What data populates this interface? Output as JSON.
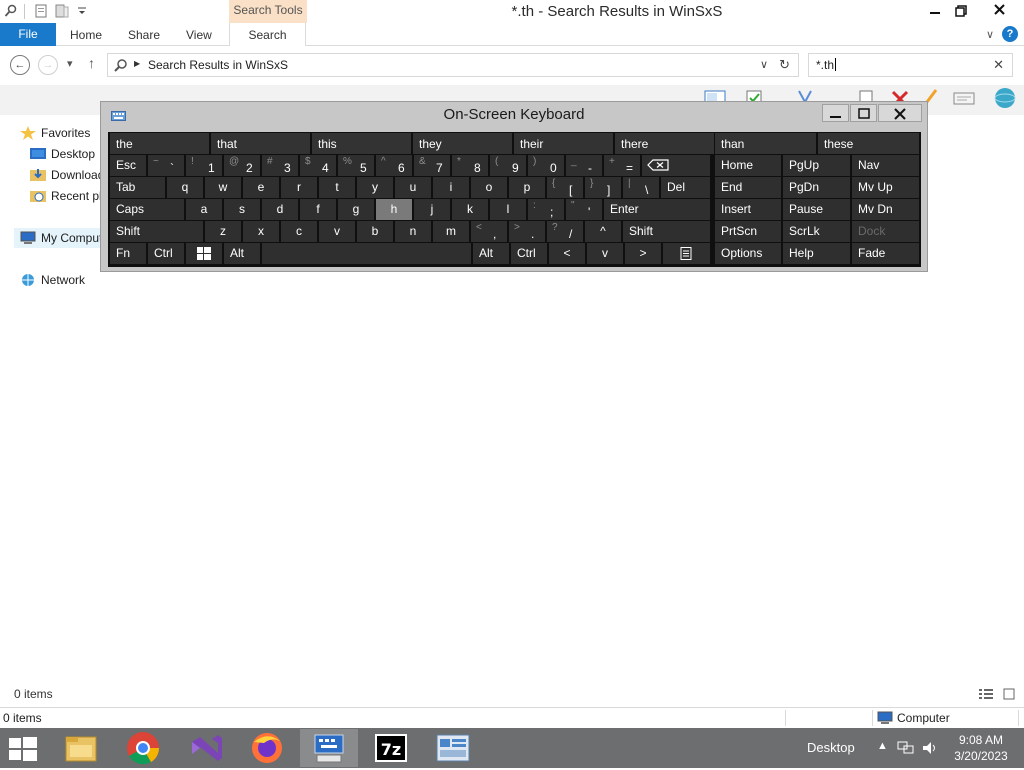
{
  "window": {
    "title": "*.th - Search Results in WinSxS",
    "context_tab": "Search Tools"
  },
  "ribbon": {
    "tabs": [
      {
        "label": "File"
      },
      {
        "label": "Home"
      },
      {
        "label": "Share"
      },
      {
        "label": "View"
      },
      {
        "label": "Search"
      }
    ],
    "help_label": "?"
  },
  "address": {
    "path": "Search Results in WinSxS"
  },
  "search": {
    "value": "*.th"
  },
  "navigation": {
    "items": [
      {
        "label": "Favorites",
        "icon": "star-icon"
      },
      {
        "label": "Desktop",
        "icon": "desktop-icon"
      },
      {
        "label": "Downloads",
        "icon": "downloads-icon"
      },
      {
        "label": "Recent places",
        "icon": "recent-places-icon"
      },
      {
        "label": "My Computer",
        "icon": "computer-icon"
      },
      {
        "label": "Network",
        "icon": "network-icon"
      }
    ]
  },
  "status": {
    "items_count": "0 items",
    "bar_items": "0 items",
    "location": "Computer"
  },
  "osk": {
    "title": "On-Screen Keyboard",
    "predictions": [
      "the",
      "that",
      "this",
      "they",
      "their",
      "there",
      "than",
      "these"
    ],
    "keys": {
      "esc": "Esc",
      "tab": "Tab",
      "caps": "Caps",
      "shift": "Shift",
      "fn": "Fn",
      "ctrl": "Ctrl",
      "alt": "Alt",
      "del": "Del",
      "enter": "Enter",
      "home": "Home",
      "pgup": "PgUp",
      "nav": "Nav",
      "end": "End",
      "pgdn": "PgDn",
      "mvup": "Mv Up",
      "insert": "Insert",
      "pause": "Pause",
      "mvdn": "Mv Dn",
      "prtscn": "PrtScn",
      "scrlk": "ScrLk",
      "dock": "Dock",
      "options": "Options",
      "help": "Help",
      "fade": "Fade"
    },
    "number_row": [
      {
        "shift": "~",
        "main": "`"
      },
      {
        "shift": "!",
        "main": "1"
      },
      {
        "shift": "@",
        "main": "2"
      },
      {
        "shift": "#",
        "main": "3"
      },
      {
        "shift": "$",
        "main": "4"
      },
      {
        "shift": "%",
        "main": "5"
      },
      {
        "shift": "^",
        "main": "6"
      },
      {
        "shift": "&",
        "main": "7"
      },
      {
        "shift": "*",
        "main": "8"
      },
      {
        "shift": "(",
        "main": "9"
      },
      {
        "shift": ")",
        "main": "0"
      },
      {
        "shift": "_",
        "main": "-"
      },
      {
        "shift": "+",
        "main": "="
      }
    ],
    "row_q": [
      "q",
      "w",
      "e",
      "r",
      "t",
      "y",
      "u",
      "i",
      "o",
      "p"
    ],
    "row_q_sym": [
      {
        "shift": "{",
        "main": "["
      },
      {
        "shift": "}",
        "main": "]"
      },
      {
        "shift": "|",
        "main": "\\"
      }
    ],
    "row_a": [
      "a",
      "s",
      "d",
      "f",
      "g",
      "h",
      "j",
      "k",
      "l"
    ],
    "row_a_sym": [
      {
        "shift": ":",
        "main": ";"
      },
      {
        "shift": "\"",
        "main": "'"
      }
    ],
    "row_z": [
      "z",
      "x",
      "c",
      "v",
      "b",
      "n",
      "m"
    ],
    "row_z_sym": [
      {
        "shift": "<",
        "main": ","
      },
      {
        "shift": ">",
        "main": "."
      },
      {
        "shift": "?",
        "main": "/"
      }
    ],
    "arrows": {
      "up": "^",
      "left": "<",
      "down": "v",
      "right": ">"
    },
    "highlighted_key": "h"
  },
  "taskbar": {
    "desktop_label": "Desktop",
    "time": "9:08 AM",
    "date": "3/20/2023",
    "apps": [
      "file-explorer",
      "chrome",
      "visual-studio",
      "firefox",
      "on-screen-keyboard",
      "7zip",
      "server-manager"
    ]
  },
  "colors": {
    "accent": "#1979ca",
    "context_tab": "#f9e0c6",
    "osk_key": "#2f2f2f",
    "osk_bg": "#0f0f0f",
    "taskbar": "#6d6e6f"
  }
}
